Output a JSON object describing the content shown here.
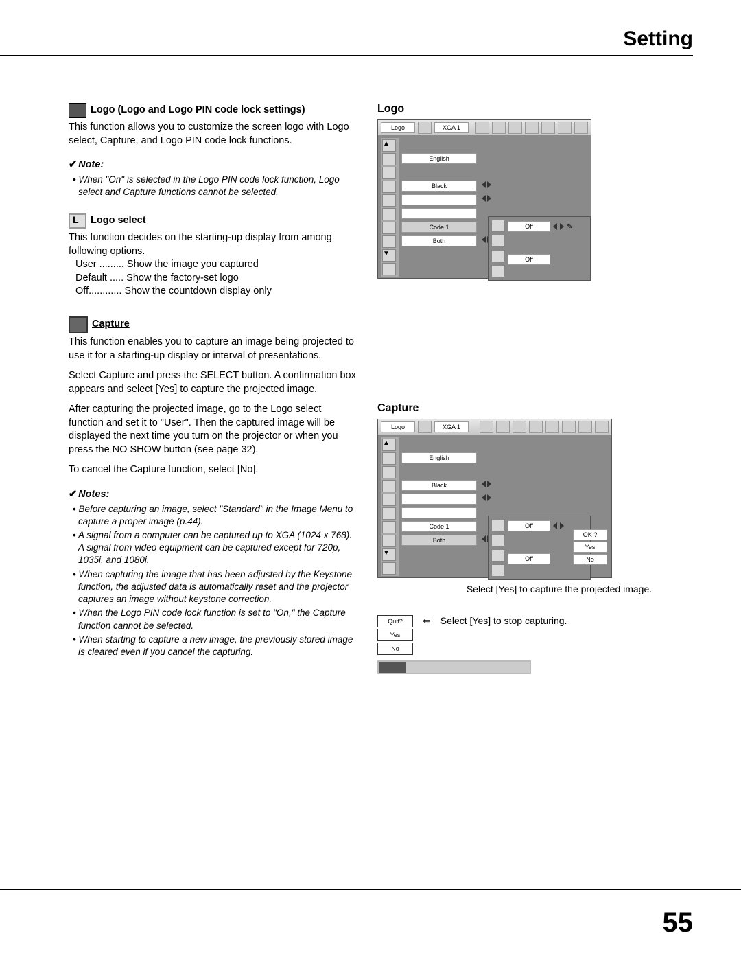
{
  "header": {
    "title": "Setting"
  },
  "left": {
    "logo_section_title": "Logo (Logo and Logo PIN code lock settings)",
    "logo_section_body": "This function allows you to customize the screen logo with Logo select, Capture, and Logo PIN code lock functions.",
    "note1_label": "Note:",
    "note1_body": "When \"On\" is selected in the Logo PIN code lock function, Logo select and Capture functions cannot be selected.",
    "logo_select_title": "Logo select",
    "logo_select_body": "This function decides on the starting-up display from among following options.",
    "opt_user": "User ......... Show the image you captured",
    "opt_default": "Default ..... Show the factory-set logo",
    "opt_off": "Off............ Show the countdown display only",
    "capture_title": "Capture",
    "capture_p1": "This function enables you to capture an image being projected to use it for a starting-up display or interval of presentations.",
    "capture_p2": "Select Capture and press the SELECT button. A confirmation box appears and select [Yes] to capture the projected image.",
    "capture_p3": "After capturing the projected image, go to the Logo select function and set it to \"User\". Then the captured image will be displayed the next time you turn on the projector or when you press the NO SHOW button (see page 32).",
    "capture_p4": "To cancel the Capture function, select [No].",
    "notes_label": "Notes:",
    "notes": [
      "Before capturing an image, select \"Standard\" in the Image Menu to capture a proper image (p.44).",
      "A signal from a computer can be captured up to XGA (1024 x 768). A signal from video equipment can be captured except for 720p, 1035i, and 1080i.",
      "When capturing the image that has been adjusted by the Keystone function, the adjusted data is automatically reset and the projector captures an image without keystone correction.",
      "When the Logo PIN code lock function is set to \"On,\" the Capture function cannot be selected.",
      "When starting to capture a new image, the previously stored image is cleared even if you cancel the capturing."
    ]
  },
  "right": {
    "logo_heading": "Logo",
    "capture_heading": "Capture",
    "caption_yes_capture": "Select [Yes] to capture the projected image.",
    "caption_yes_stop": "Select [Yes] to stop capturing.",
    "osd": {
      "top_label": "Logo",
      "mode": "XGA 1",
      "menu": [
        "English",
        "Black",
        "",
        "",
        "Code 1",
        "Both"
      ],
      "sub_off1": "Off",
      "sub_off2": "Off"
    },
    "confirm": {
      "ok": "OK ?",
      "yes": "Yes",
      "no": "No"
    },
    "quit": {
      "quit": "Quit?",
      "yes": "Yes",
      "no": "No"
    }
  },
  "page_number": "55"
}
